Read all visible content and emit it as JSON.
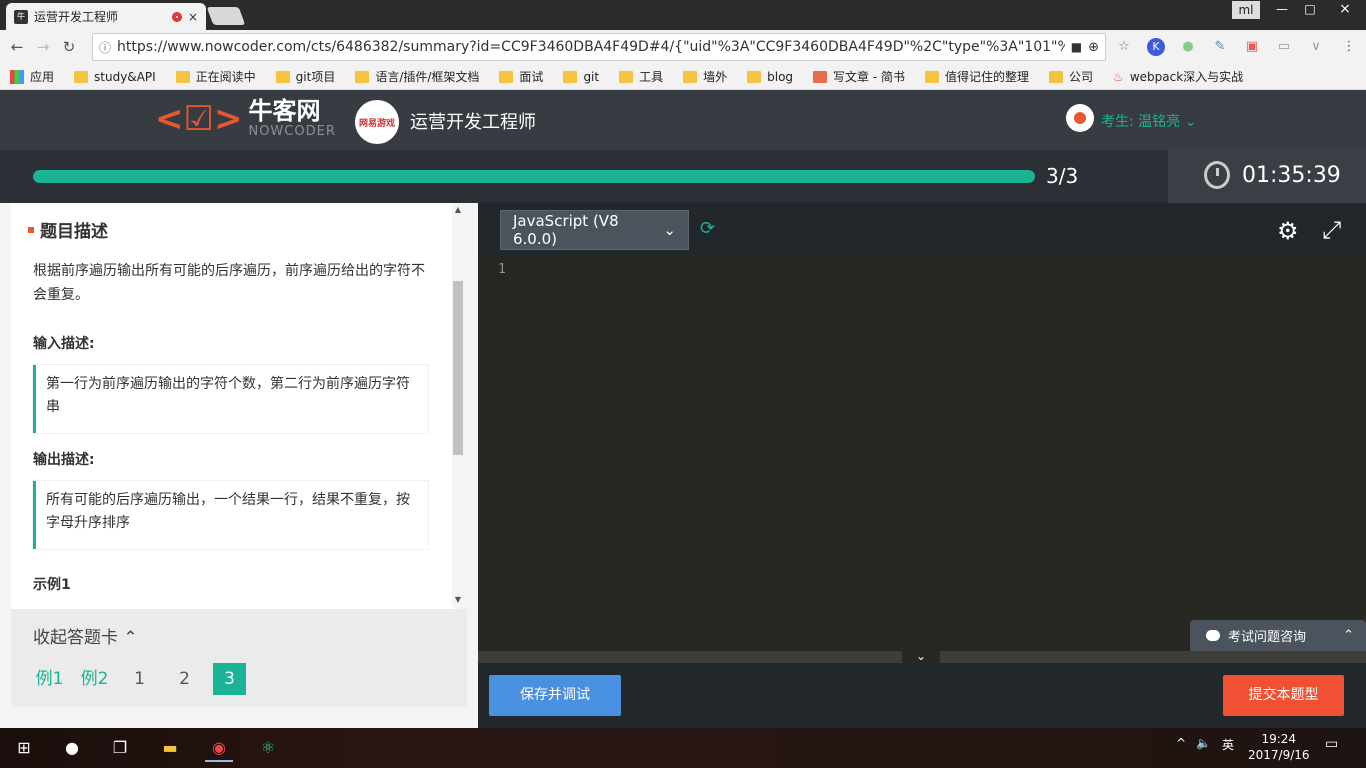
{
  "browser": {
    "tab_title": "运营开发工程师",
    "tab_close": "×",
    "favicon_text": "牛",
    "user_label": "ml",
    "win_min": "—",
    "win_max": "□",
    "win_close": "×",
    "url": "https://www.nowcoder.com/cts/6486382/summary?id=CC9F3460DBA4F49D#4/{\"uid\"%3A\"CC9F3460DBA4F49D\"%2C\"type\"%3A\"101\"%2...",
    "bookmarks": [
      "应用",
      "study&API",
      "正在阅读中",
      "git项目",
      "语言/插件/框架文档",
      "面试",
      "git",
      "工具",
      "墙外",
      "blog",
      "写文章 - 简书",
      "值得记住的整理",
      "公司",
      "webpack深入与实战"
    ]
  },
  "site": {
    "logo_cn": "牛客网",
    "logo_en": "NOWCODER",
    "company_logo_text": "网易游戏",
    "job_title": "运营开发工程师",
    "candidate": "考生: 温铭亮",
    "progress": {
      "current": 3,
      "total": 3,
      "label": "3/3",
      "fraction": 1.0
    },
    "timer": "01:35:39"
  },
  "problem": {
    "section_title": "题目描述",
    "description": "根据前序遍历输出所有可能的后序遍历，前序遍历给出的字符不会重复。",
    "input_label": "输入描述:",
    "input_text": "第一行为前序遍历输出的字符个数，第二行为前序遍历字符串",
    "output_label": "输出描述:",
    "output_text": "所有可能的后序遍历输出，一个结果一行，结果不重复，按字母升序排序",
    "example_label": "示例1"
  },
  "answer_card": {
    "toggle_label": "收起答题卡",
    "questions": [
      {
        "label": "例1",
        "kind": "example"
      },
      {
        "label": "例2",
        "kind": "example"
      },
      {
        "label": "1",
        "kind": "normal"
      },
      {
        "label": "2",
        "kind": "normal"
      },
      {
        "label": "3",
        "kind": "active"
      }
    ]
  },
  "editor": {
    "language": "JavaScript (V8 6.0.0)",
    "line_numbers": [
      "1"
    ],
    "save_label": "保存并调试",
    "submit_label": "提交本题型",
    "consult_label": "考试问题咨询"
  },
  "taskbar": {
    "ime": "英",
    "time": "19:24",
    "date": "2017/9/16"
  },
  "colors": {
    "accent": "#1ab394",
    "brand_orange": "#e8572f",
    "save_blue": "#4a90e2",
    "submit_red": "#f05033"
  }
}
